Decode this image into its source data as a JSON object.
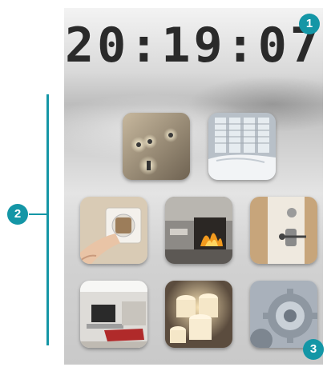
{
  "clock": {
    "time": "20:19:07"
  },
  "callouts": {
    "c1": "1",
    "c2": "2",
    "c3": "3"
  },
  "tiles": [
    {
      "name": "lighting",
      "icon": "spotlight-icon"
    },
    {
      "name": "blinds",
      "icon": "window-blinds-icon"
    },
    {
      "name": "power-outlet",
      "icon": "plug-icon"
    },
    {
      "name": "fireplace",
      "icon": "fireplace-icon"
    },
    {
      "name": "door-lock",
      "icon": "key-lock-icon"
    },
    {
      "name": "living-room",
      "icon": "tv-room-icon"
    },
    {
      "name": "candles",
      "icon": "candles-icon"
    },
    {
      "name": "settings",
      "icon": "gears-icon"
    }
  ],
  "colors": {
    "accent": "#1496a6"
  }
}
